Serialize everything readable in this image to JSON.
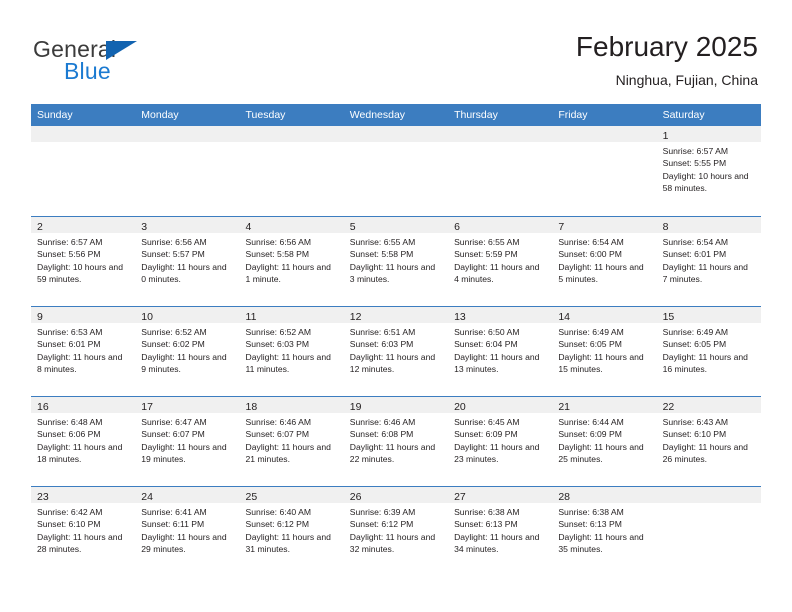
{
  "brand": {
    "name_primary": "General",
    "name_secondary": "Blue",
    "triangle_color": "#1263b0",
    "blue_text_color": "#1b7ad1"
  },
  "header": {
    "title": "February 2025",
    "location": "Ninghua, Fujian, China",
    "header_bg_color": "#3c7dc0",
    "day_band_color": "#f0f0f0"
  },
  "weekdays": [
    "Sunday",
    "Monday",
    "Tuesday",
    "Wednesday",
    "Thursday",
    "Friday",
    "Saturday"
  ],
  "weeks": [
    [
      {
        "day": "",
        "sunrise": "",
        "sunset": "",
        "daylight": "",
        "empty": true
      },
      {
        "day": "",
        "sunrise": "",
        "sunset": "",
        "daylight": "",
        "empty": true
      },
      {
        "day": "",
        "sunrise": "",
        "sunset": "",
        "daylight": "",
        "empty": true
      },
      {
        "day": "",
        "sunrise": "",
        "sunset": "",
        "daylight": "",
        "empty": true
      },
      {
        "day": "",
        "sunrise": "",
        "sunset": "",
        "daylight": "",
        "empty": true
      },
      {
        "day": "",
        "sunrise": "",
        "sunset": "",
        "daylight": "",
        "empty": true
      },
      {
        "day": "1",
        "sunrise": "Sunrise: 6:57 AM",
        "sunset": "Sunset: 5:55 PM",
        "daylight": "Daylight: 10 hours and 58 minutes.",
        "empty": false
      }
    ],
    [
      {
        "day": "2",
        "sunrise": "Sunrise: 6:57 AM",
        "sunset": "Sunset: 5:56 PM",
        "daylight": "Daylight: 10 hours and 59 minutes.",
        "empty": false
      },
      {
        "day": "3",
        "sunrise": "Sunrise: 6:56 AM",
        "sunset": "Sunset: 5:57 PM",
        "daylight": "Daylight: 11 hours and 0 minutes.",
        "empty": false
      },
      {
        "day": "4",
        "sunrise": "Sunrise: 6:56 AM",
        "sunset": "Sunset: 5:58 PM",
        "daylight": "Daylight: 11 hours and 1 minute.",
        "empty": false
      },
      {
        "day": "5",
        "sunrise": "Sunrise: 6:55 AM",
        "sunset": "Sunset: 5:58 PM",
        "daylight": "Daylight: 11 hours and 3 minutes.",
        "empty": false
      },
      {
        "day": "6",
        "sunrise": "Sunrise: 6:55 AM",
        "sunset": "Sunset: 5:59 PM",
        "daylight": "Daylight: 11 hours and 4 minutes.",
        "empty": false
      },
      {
        "day": "7",
        "sunrise": "Sunrise: 6:54 AM",
        "sunset": "Sunset: 6:00 PM",
        "daylight": "Daylight: 11 hours and 5 minutes.",
        "empty": false
      },
      {
        "day": "8",
        "sunrise": "Sunrise: 6:54 AM",
        "sunset": "Sunset: 6:01 PM",
        "daylight": "Daylight: 11 hours and 7 minutes.",
        "empty": false
      }
    ],
    [
      {
        "day": "9",
        "sunrise": "Sunrise: 6:53 AM",
        "sunset": "Sunset: 6:01 PM",
        "daylight": "Daylight: 11 hours and 8 minutes.",
        "empty": false
      },
      {
        "day": "10",
        "sunrise": "Sunrise: 6:52 AM",
        "sunset": "Sunset: 6:02 PM",
        "daylight": "Daylight: 11 hours and 9 minutes.",
        "empty": false
      },
      {
        "day": "11",
        "sunrise": "Sunrise: 6:52 AM",
        "sunset": "Sunset: 6:03 PM",
        "daylight": "Daylight: 11 hours and 11 minutes.",
        "empty": false
      },
      {
        "day": "12",
        "sunrise": "Sunrise: 6:51 AM",
        "sunset": "Sunset: 6:03 PM",
        "daylight": "Daylight: 11 hours and 12 minutes.",
        "empty": false
      },
      {
        "day": "13",
        "sunrise": "Sunrise: 6:50 AM",
        "sunset": "Sunset: 6:04 PM",
        "daylight": "Daylight: 11 hours and 13 minutes.",
        "empty": false
      },
      {
        "day": "14",
        "sunrise": "Sunrise: 6:49 AM",
        "sunset": "Sunset: 6:05 PM",
        "daylight": "Daylight: 11 hours and 15 minutes.",
        "empty": false
      },
      {
        "day": "15",
        "sunrise": "Sunrise: 6:49 AM",
        "sunset": "Sunset: 6:05 PM",
        "daylight": "Daylight: 11 hours and 16 minutes.",
        "empty": false
      }
    ],
    [
      {
        "day": "16",
        "sunrise": "Sunrise: 6:48 AM",
        "sunset": "Sunset: 6:06 PM",
        "daylight": "Daylight: 11 hours and 18 minutes.",
        "empty": false
      },
      {
        "day": "17",
        "sunrise": "Sunrise: 6:47 AM",
        "sunset": "Sunset: 6:07 PM",
        "daylight": "Daylight: 11 hours and 19 minutes.",
        "empty": false
      },
      {
        "day": "18",
        "sunrise": "Sunrise: 6:46 AM",
        "sunset": "Sunset: 6:07 PM",
        "daylight": "Daylight: 11 hours and 21 minutes.",
        "empty": false
      },
      {
        "day": "19",
        "sunrise": "Sunrise: 6:46 AM",
        "sunset": "Sunset: 6:08 PM",
        "daylight": "Daylight: 11 hours and 22 minutes.",
        "empty": false
      },
      {
        "day": "20",
        "sunrise": "Sunrise: 6:45 AM",
        "sunset": "Sunset: 6:09 PM",
        "daylight": "Daylight: 11 hours and 23 minutes.",
        "empty": false
      },
      {
        "day": "21",
        "sunrise": "Sunrise: 6:44 AM",
        "sunset": "Sunset: 6:09 PM",
        "daylight": "Daylight: 11 hours and 25 minutes.",
        "empty": false
      },
      {
        "day": "22",
        "sunrise": "Sunrise: 6:43 AM",
        "sunset": "Sunset: 6:10 PM",
        "daylight": "Daylight: 11 hours and 26 minutes.",
        "empty": false
      }
    ],
    [
      {
        "day": "23",
        "sunrise": "Sunrise: 6:42 AM",
        "sunset": "Sunset: 6:10 PM",
        "daylight": "Daylight: 11 hours and 28 minutes.",
        "empty": false
      },
      {
        "day": "24",
        "sunrise": "Sunrise: 6:41 AM",
        "sunset": "Sunset: 6:11 PM",
        "daylight": "Daylight: 11 hours and 29 minutes.",
        "empty": false
      },
      {
        "day": "25",
        "sunrise": "Sunrise: 6:40 AM",
        "sunset": "Sunset: 6:12 PM",
        "daylight": "Daylight: 11 hours and 31 minutes.",
        "empty": false
      },
      {
        "day": "26",
        "sunrise": "Sunrise: 6:39 AM",
        "sunset": "Sunset: 6:12 PM",
        "daylight": "Daylight: 11 hours and 32 minutes.",
        "empty": false
      },
      {
        "day": "27",
        "sunrise": "Sunrise: 6:38 AM",
        "sunset": "Sunset: 6:13 PM",
        "daylight": "Daylight: 11 hours and 34 minutes.",
        "empty": false
      },
      {
        "day": "28",
        "sunrise": "Sunrise: 6:38 AM",
        "sunset": "Sunset: 6:13 PM",
        "daylight": "Daylight: 11 hours and 35 minutes.",
        "empty": false
      },
      {
        "day": "",
        "sunrise": "",
        "sunset": "",
        "daylight": "",
        "empty": true
      }
    ]
  ]
}
